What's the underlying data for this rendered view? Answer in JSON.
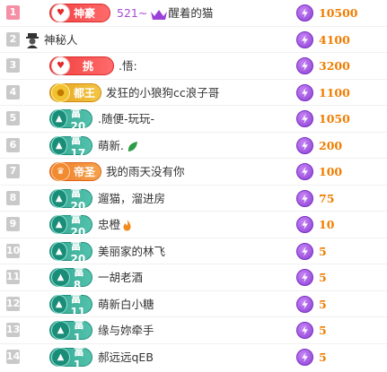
{
  "colors": {
    "score_orange": "#f07d00",
    "bolt_purple": "#8a3fd4",
    "rank_gray": "#c9c9c9",
    "rank_top_pink": "#f48fa6",
    "name_highlight": "#a64ad8"
  },
  "rows": [
    {
      "rank": "1",
      "badge": "神豪",
      "badge_style": "red",
      "name_prefix": "521~",
      "name": "醒着的猫",
      "score": "10500"
    },
    {
      "rank": "2",
      "badge": "",
      "name": "神秘人",
      "score": "4100"
    },
    {
      "rank": "3",
      "badge": "挑",
      "badge_style": "red",
      "name": ".悟:",
      "score": "3200"
    },
    {
      "rank": "4",
      "badge": "都王",
      "badge_style": "gold",
      "name": "发狂的小狼狗cc浪子哥",
      "score": "1100"
    },
    {
      "rank": "5",
      "badge": "富20",
      "badge_style": "teal",
      "name": ".随便-玩玩-",
      "score": "1050"
    },
    {
      "rank": "6",
      "badge": "富17",
      "badge_style": "teal",
      "name": "萌新.",
      "score": "200"
    },
    {
      "rank": "7",
      "badge": "帝圣",
      "badge_style": "orange",
      "name": "我的雨天没有你",
      "score": "100"
    },
    {
      "rank": "8",
      "badge": "富20",
      "badge_style": "teal",
      "name": "遛猫，溜进房",
      "score": "75"
    },
    {
      "rank": "9",
      "badge": "富20",
      "badge_style": "teal",
      "name": "忠橙",
      "score": "10"
    },
    {
      "rank": "10",
      "badge": "富20",
      "badge_style": "teal",
      "name": "美丽家的林飞",
      "score": "5"
    },
    {
      "rank": "11",
      "badge": "富8",
      "badge_style": "teal",
      "name": "一胡老酒",
      "score": "5"
    },
    {
      "rank": "12",
      "badge": "富11",
      "badge_style": "teal",
      "name": "萌新白小糖",
      "score": "5"
    },
    {
      "rank": "13",
      "badge": "富1",
      "badge_style": "teal",
      "name": "缘与妳牵手",
      "score": "5"
    },
    {
      "rank": "14",
      "badge": "富1",
      "badge_style": "teal",
      "name": "郝远远qEB",
      "score": "5"
    }
  ]
}
